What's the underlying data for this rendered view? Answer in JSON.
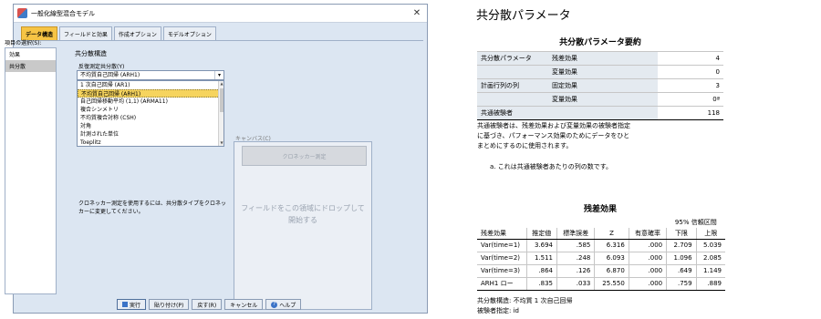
{
  "dialog": {
    "title": "一般化線型混合モデル",
    "close_glyph": "✕",
    "tabs": [
      "データ構造",
      "フィールドと効果",
      "作成オプション",
      "モデルオプション"
    ],
    "item_select_label": "項目の選択(S):",
    "items": [
      "効果",
      "共分散"
    ],
    "section_title": "共分散構造",
    "struct_label": "反復測定共分散(Y)",
    "combo_value": "不均質自己回帰 (ARH1)",
    "dropdown_options": [
      "1 次自己回帰 (AR1)",
      "不均質自己回帰 (ARH1)",
      "自己回帰移動平均 (1,1) (ARMA11)",
      "複合シンメトリ",
      "不均質複合対称 (CSH)",
      "対角",
      "計測された単位",
      "Toeplitz"
    ],
    "canvas_label": "キャンバス(C)",
    "kron_button": "クロネッカー測定",
    "drop_hint": "フィールドをこの領域にドロップして開始する",
    "kron_note": "クロネッカー測定を使用するには、共分散タイプをクロネッカーに変更してください。",
    "buttons": {
      "run": "実行",
      "paste": "貼り付け(P)",
      "reset": "戻す(R)",
      "cancel": "キャンセル",
      "help": "ヘルプ"
    },
    "help_glyph": "?"
  },
  "output": {
    "heading": "共分散パラメータ",
    "summary_title": "共分散パラメータ要約",
    "summary_rows": [
      {
        "group": "共分散パラメータ",
        "label": "残差効果",
        "value": "4"
      },
      {
        "group": "",
        "label": "変量効果",
        "value": "0"
      },
      {
        "group": "計画行列の列",
        "label": "固定効果",
        "value": "3"
      },
      {
        "group": "",
        "label": "変量効果",
        "value": "0ª"
      },
      {
        "group": "共通被験者",
        "label": "",
        "value": "118"
      }
    ],
    "summary_note": "共通被験者は、残差効果および変量効果の被験者指定に基づき、パフォーマンス効果のためにデータをひとまとめにするのに使用されます。",
    "summary_footnote": "a. これは共通被験者あたりの列の数です。",
    "residual_title": "残差効果",
    "ci_header": "95% 信頼区間",
    "residual_headers": [
      "残差効果",
      "推定値",
      "標準誤差",
      "Z",
      "有意確率",
      "下限",
      "上限"
    ],
    "residual_rows": [
      [
        "Var(time=1)",
        "3.694",
        ".585",
        "6.316",
        ".000",
        "2.709",
        "5.039"
      ],
      [
        "Var(time=2)",
        "1.511",
        ".248",
        "6.093",
        ".000",
        "1.096",
        "2.085"
      ],
      [
        "Var(time=3)",
        ".864",
        ".126",
        "6.870",
        ".000",
        ".649",
        "1.149"
      ],
      [
        "ARH1 ロー",
        ".835",
        ".033",
        "25.550",
        ".000",
        ".759",
        ".889"
      ]
    ],
    "residual_note1": "共分散構造: 不均質 1 次自己回帰",
    "residual_note2": "被験者指定: id"
  }
}
